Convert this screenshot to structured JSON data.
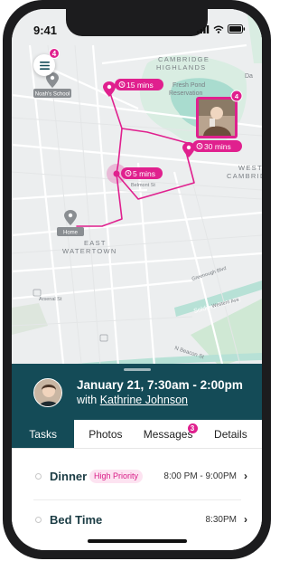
{
  "status_bar": {
    "time": "9:41"
  },
  "menu": {
    "badge": "4"
  },
  "map": {
    "labels": {
      "cambridge_highlands": "CAMBRIDGE\nHIGHLANDS",
      "fresh_pond": "Fresh Pond\nReservation",
      "west_cambridge": "WEST\nCAMBRID",
      "east_watertown": "EAST\nWATERTOWN",
      "belmont_st": "Belmont St",
      "soldiers_field": "Soldiers Field Rd",
      "n_beacon": "N Beacon St",
      "arsenal_st": "Arsenal St",
      "greenough": "Greenough Blvd",
      "western_ave": "Western Ave",
      "da": "Da"
    },
    "places": {
      "school": "Noah's School",
      "home": "Home"
    },
    "time_badges": {
      "top": "15 mins",
      "middle": "5 mins",
      "right": "30 mins"
    },
    "photo_badge": "4"
  },
  "sheet": {
    "title": "January 21, 7:30am - 2:00pm",
    "subtitle_prefix": "with ",
    "subtitle_name": "Kathrine Johnson"
  },
  "tabs": [
    {
      "label": "Tasks",
      "active": true
    },
    {
      "label": "Photos",
      "active": false
    },
    {
      "label": "Messages",
      "active": false,
      "badge": "3"
    },
    {
      "label": "Details",
      "active": false
    }
  ],
  "tasks": [
    {
      "name": "Dinner",
      "priority": "High Priority",
      "time": "8:00 PM - 9:00PM"
    },
    {
      "name": "Bed Time",
      "priority": "",
      "time": "8:30PM"
    }
  ],
  "colors": {
    "accent": "#e0208e",
    "header": "#144b57",
    "map_bg": "#eceeef",
    "water": "#a9dccf"
  },
  "icons": {
    "menu": "hamburger-icon",
    "chevron": "chevron-right-icon",
    "pin": "map-pin-icon",
    "clock": "clock-icon",
    "signal": "signal-icon",
    "wifi": "wifi-icon",
    "battery": "battery-icon"
  }
}
